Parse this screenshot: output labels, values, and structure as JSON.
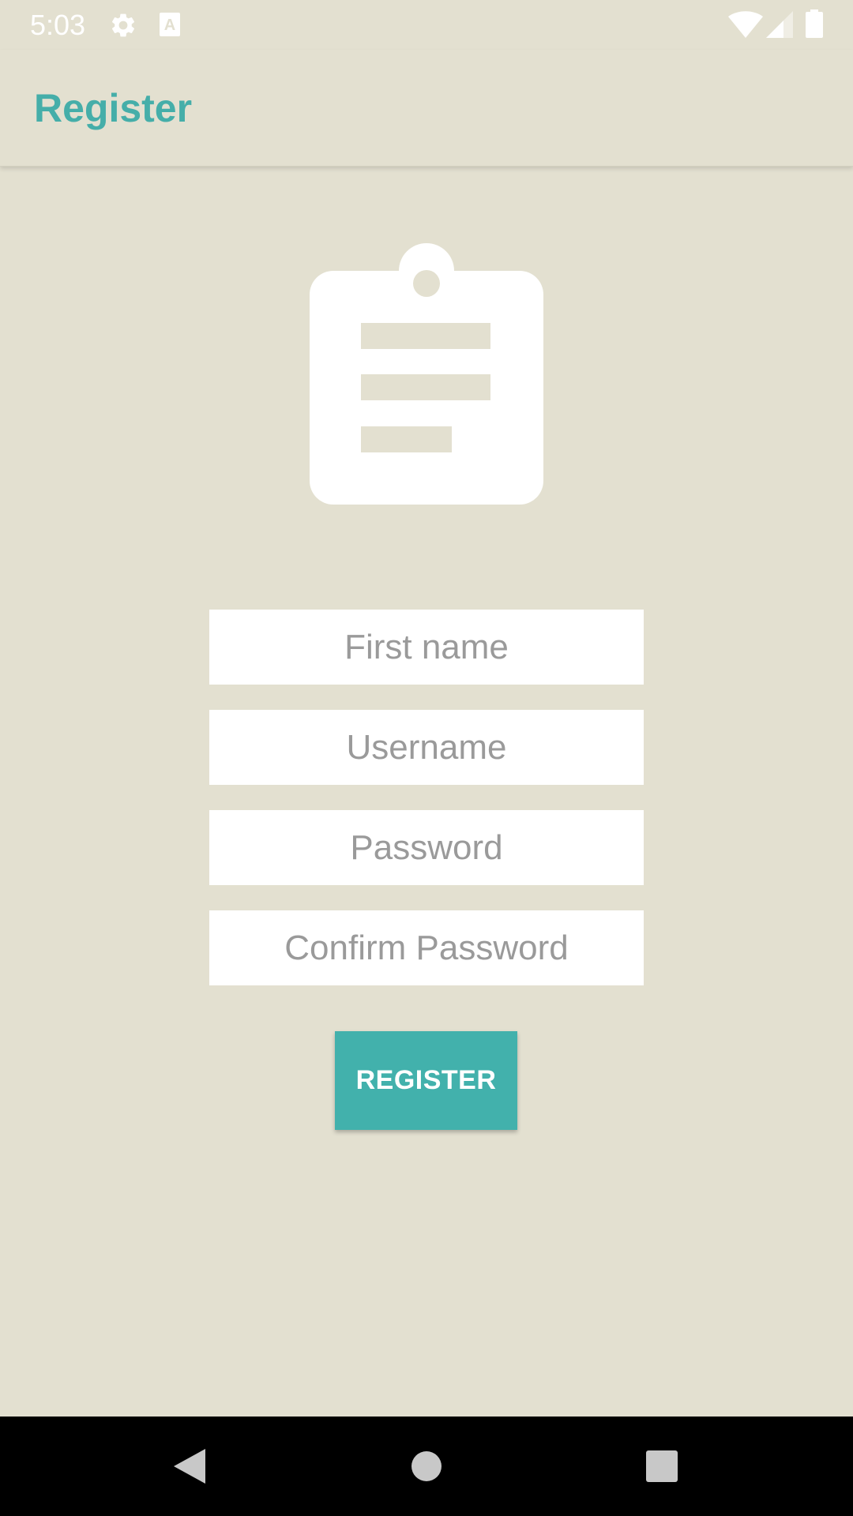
{
  "status_bar": {
    "time": "5:03",
    "icons": [
      "settings-icon",
      "text-a-icon",
      "wifi-icon",
      "cell-signal-icon",
      "battery-icon"
    ]
  },
  "app_bar": {
    "title": "Register"
  },
  "header_icon": "clipboard-icon",
  "form": {
    "first_name_placeholder": "First name",
    "username_placeholder": "Username",
    "password_placeholder": "Password",
    "confirm_password_placeholder": "Confirm Password",
    "register_label": "REGISTER"
  },
  "nav_bar": {
    "icons": [
      "back-icon",
      "home-icon",
      "recents-icon"
    ]
  },
  "colors": {
    "background": "#e3e0d0",
    "accent": "#42b1ac",
    "title": "#45aea9",
    "field_background": "#ffffff",
    "placeholder": "#9a9a9a"
  }
}
